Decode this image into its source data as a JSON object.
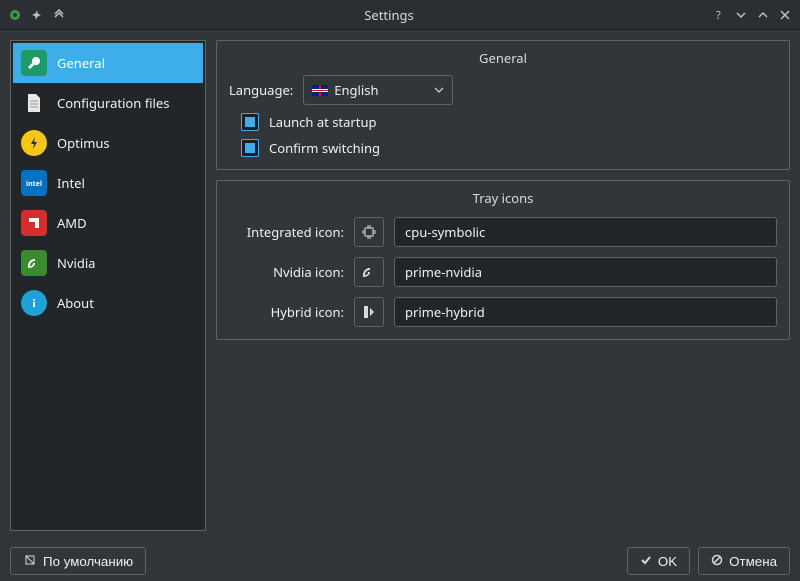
{
  "window": {
    "title": "Settings"
  },
  "sidebar": {
    "items": [
      {
        "label": "General"
      },
      {
        "label": "Configuration files"
      },
      {
        "label": "Optimus"
      },
      {
        "label": "Intel"
      },
      {
        "label": "AMD"
      },
      {
        "label": "Nvidia"
      },
      {
        "label": "About"
      }
    ]
  },
  "general": {
    "heading": "General",
    "language_label": "Language:",
    "language_value": "English",
    "launch_at_startup": "Launch at startup",
    "confirm_switching": "Confirm switching"
  },
  "tray": {
    "heading": "Tray icons",
    "integrated_label": "Integrated icon:",
    "integrated_value": "cpu-symbolic",
    "nvidia_label": "Nvidia icon:",
    "nvidia_value": "prime-nvidia",
    "hybrid_label": "Hybrid icon:",
    "hybrid_value": "prime-hybrid"
  },
  "footer": {
    "defaults": "По умолчанию",
    "ok": "OK",
    "cancel": "Отмена"
  }
}
